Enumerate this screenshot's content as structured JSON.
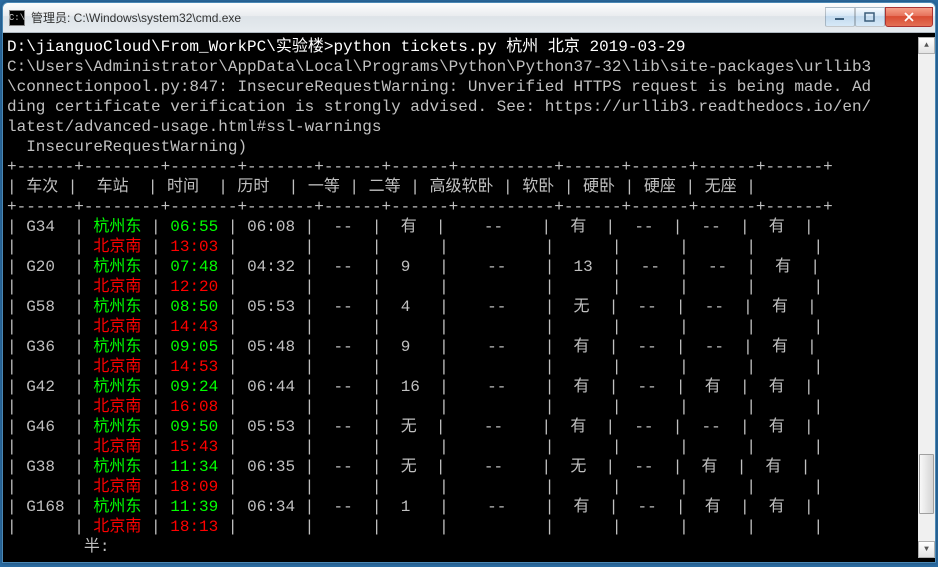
{
  "window": {
    "title": "管理员: C:\\Windows\\system32\\cmd.exe",
    "icon_label": "C:\\"
  },
  "console": {
    "prompt_line": "D:\\jianguoCloud\\From_WorkPC\\实验楼>python tickets.py 杭州 北京 2019-03-29",
    "warn1": "C:\\Users\\Administrator\\AppData\\Local\\Programs\\Python\\Python37-32\\lib\\site-packages\\urllib3",
    "warn2": "\\connectionpool.py:847: InsecureRequestWarning: Unverified HTTPS request is being made. Ad",
    "warn3": "ding certificate verification is strongly advised. See: https://urllib3.readthedocs.io/en/",
    "warn4": "latest/advanced-usage.html#ssl-warnings",
    "warn5": "  InsecureRequestWarning)",
    "footer": "        半:"
  },
  "headers": [
    "车次",
    "车站",
    "时间",
    "历时",
    "一等",
    "二等",
    "高级软卧",
    "软卧",
    "硬卧",
    "硬座",
    "无座"
  ],
  "rows": [
    {
      "train": "G34",
      "from": "杭州东",
      "to": "北京南",
      "dep": "06:55",
      "arr": "13:03",
      "dur": "06:08",
      "c1": "--",
      "c2": "有",
      "gsw": "--",
      "sw": "有",
      "hw": "--",
      "hs": "--",
      "ns": "有"
    },
    {
      "train": "G20",
      "from": "杭州东",
      "to": "北京南",
      "dep": "07:48",
      "arr": "12:20",
      "dur": "04:32",
      "c1": "--",
      "c2": "9",
      "gsw": "--",
      "sw": "13",
      "hw": "--",
      "hs": "--",
      "ns": "有"
    },
    {
      "train": "G58",
      "from": "杭州东",
      "to": "北京南",
      "dep": "08:50",
      "arr": "14:43",
      "dur": "05:53",
      "c1": "--",
      "c2": "4",
      "gsw": "--",
      "sw": "无",
      "hw": "--",
      "hs": "--",
      "ns": "有"
    },
    {
      "train": "G36",
      "from": "杭州东",
      "to": "北京南",
      "dep": "09:05",
      "arr": "14:53",
      "dur": "05:48",
      "c1": "--",
      "c2": "9",
      "gsw": "--",
      "sw": "有",
      "hw": "--",
      "hs": "--",
      "ns": "有"
    },
    {
      "train": "G42",
      "from": "杭州东",
      "to": "北京南",
      "dep": "09:24",
      "arr": "16:08",
      "dur": "06:44",
      "c1": "--",
      "c2": "16",
      "gsw": "--",
      "sw": "有",
      "hw": "--",
      "hs": "有",
      "ns": "有"
    },
    {
      "train": "G46",
      "from": "杭州东",
      "to": "北京南",
      "dep": "09:50",
      "arr": "15:43",
      "dur": "05:53",
      "c1": "--",
      "c2": "无",
      "gsw": "--",
      "sw": "有",
      "hw": "--",
      "hs": "--",
      "ns": "有"
    },
    {
      "train": "G38",
      "from": "杭州东",
      "to": "北京南",
      "dep": "11:34",
      "arr": "18:09",
      "dur": "06:35",
      "c1": "--",
      "c2": "无",
      "gsw": "--",
      "sw": "无",
      "hw": "--",
      "hs": "有",
      "ns": "有"
    },
    {
      "train": "G168",
      "from": "杭州东",
      "to": "北京南",
      "dep": "11:39",
      "arr": "18:13",
      "dur": "06:34",
      "c1": "--",
      "c2": "1",
      "gsw": "--",
      "sw": "有",
      "hw": "--",
      "hs": "有",
      "ns": "有"
    }
  ]
}
